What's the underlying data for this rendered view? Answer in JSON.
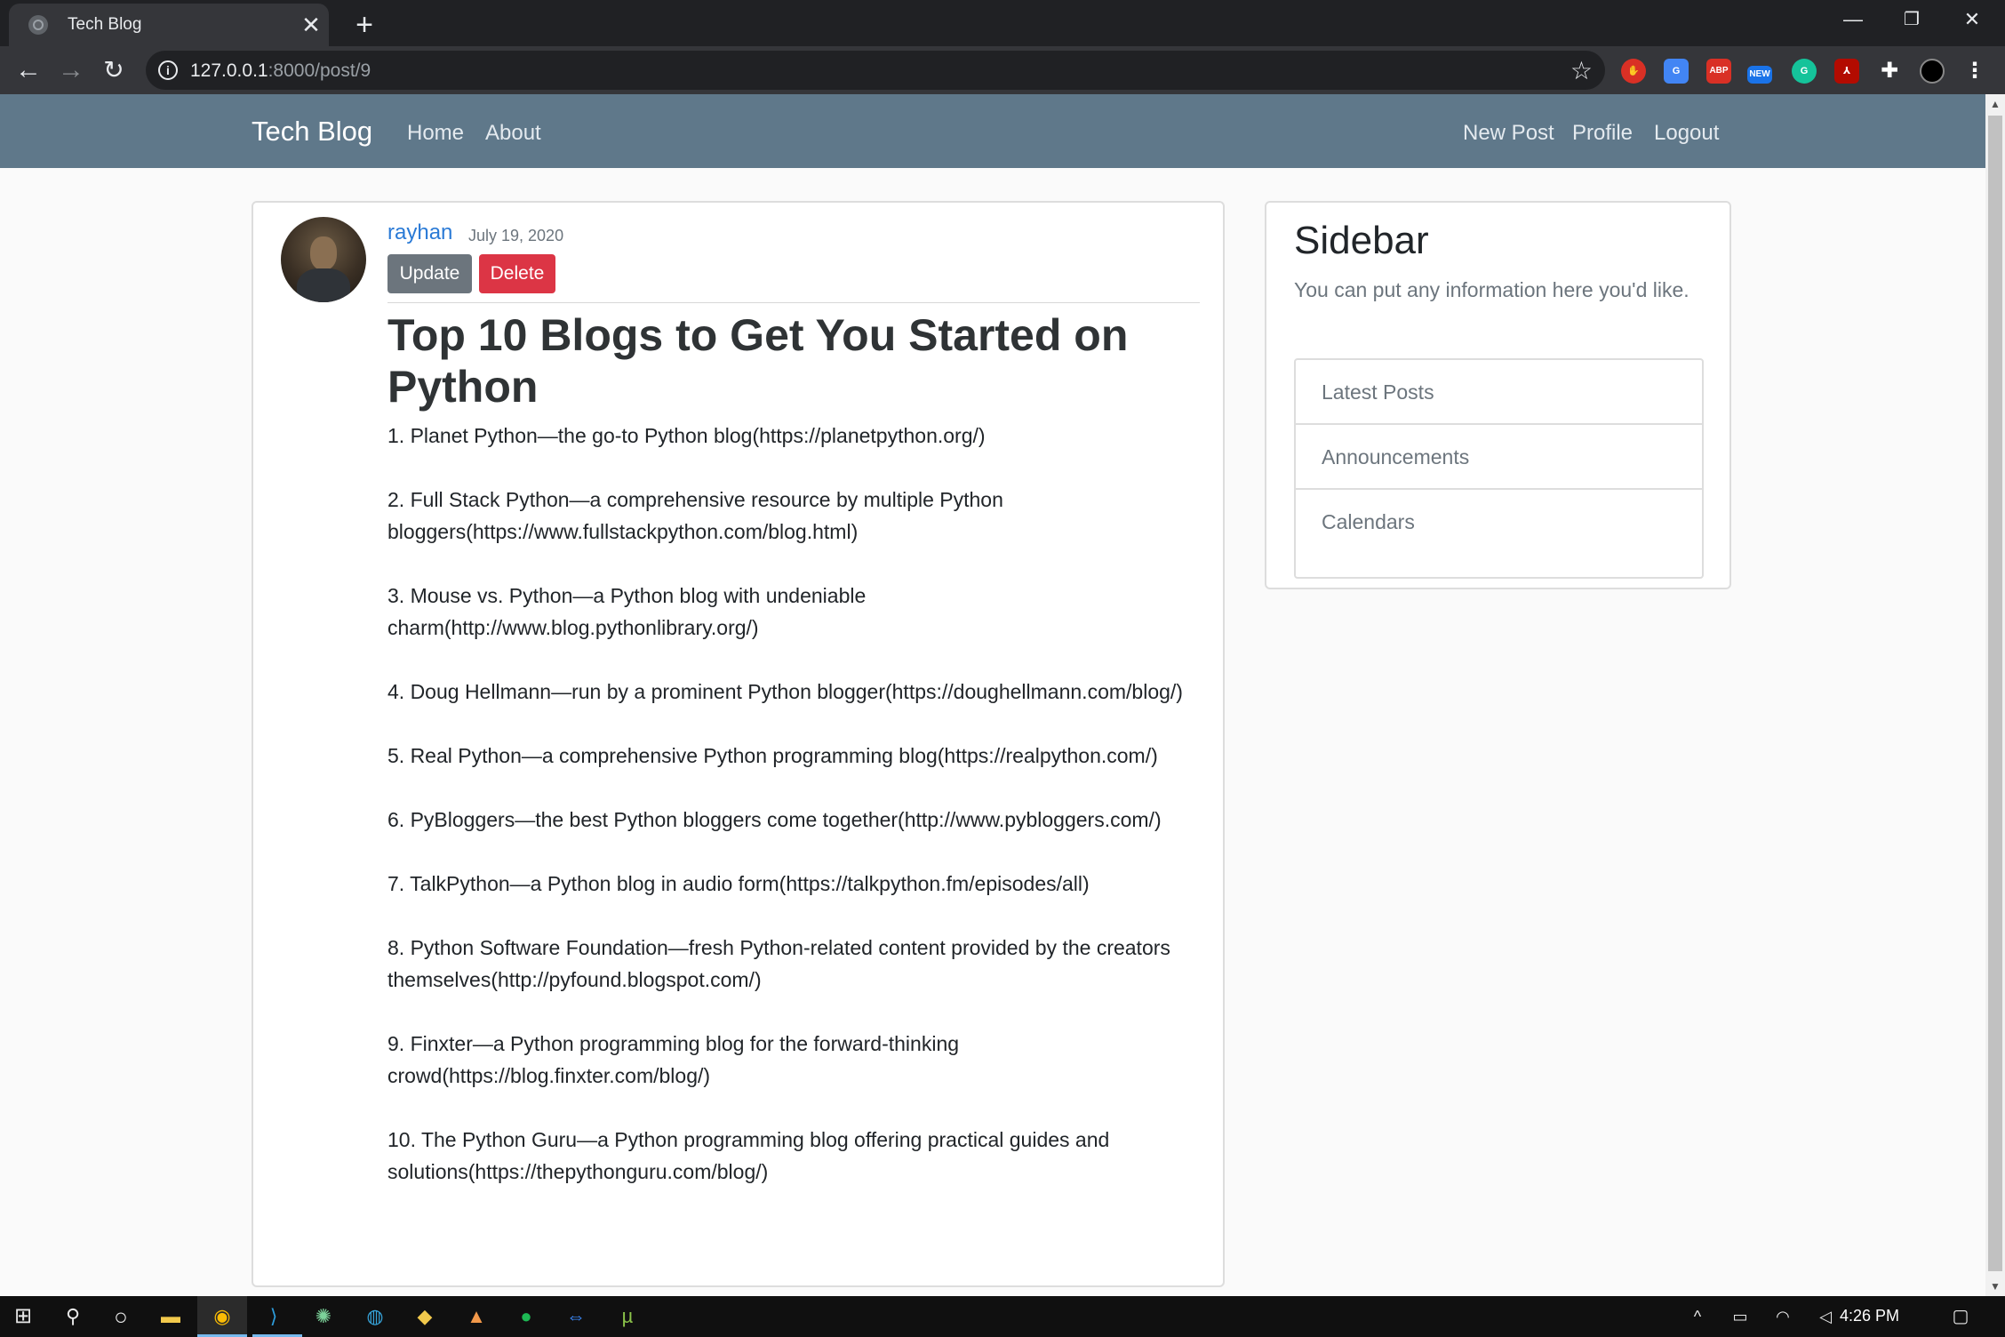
{
  "browser": {
    "tab_title": "Tech Blog",
    "tab_close": "✕",
    "new_tab": "+",
    "url_host": "127.0.0.1",
    "url_rest": ":8000/post/9",
    "extensions": [
      "ABP",
      "NEW"
    ],
    "window_controls": [
      "—",
      "❐",
      "✕"
    ]
  },
  "site": {
    "brand": "Tech Blog",
    "nav_left": [
      "Home",
      "About"
    ],
    "nav_right": [
      "New Post",
      "Profile",
      "Logout"
    ]
  },
  "post": {
    "author": "rayhan",
    "date": "July 19, 2020",
    "update_label": "Update",
    "delete_label": "Delete",
    "title": "Top 10 Blogs to Get You Started on Python",
    "items": [
      "1. Planet Python—the go-to Python blog(https://planetpython.org/)",
      "2. Full Stack Python—a comprehensive resource by multiple Python bloggers(https://www.fullstackpython.com/blog.html)",
      "3. Mouse vs. Python—a Python blog with undeniable charm(http://www.blog.pythonlibrary.org/)",
      "4. Doug Hellmann—run by a prominent Python blogger(https://doughellmann.com/blog/)",
      "5. Real Python—a comprehensive Python programming blog(https://realpython.com/)",
      "6. PyBloggers—the best Python bloggers come together(http://www.pybloggers.com/)",
      "7. TalkPython—a Python blog in audio form(https://talkpython.fm/episodes/all)",
      "8. Python Software Foundation—fresh Python-related content provided by the creators themselves(http://pyfound.blogspot.com/)",
      "9. Finxter—a Python programming blog for the forward-thinking crowd(https://blog.finxter.com/blog/)",
      "10. The Python Guru—a Python programming blog offering practical guides and solutions(https://thepythonguru.com/blog/)"
    ]
  },
  "sidebar": {
    "title": "Sidebar",
    "lead": "You can put any information here you'd like.",
    "items": [
      "Latest Posts",
      "Announcements",
      "Calendars"
    ]
  },
  "taskbar": {
    "clock": "4:26 PM"
  },
  "colors": {
    "navbar": "#5f788a",
    "link": "#2a7ad6",
    "update": "#6c757d",
    "delete": "#dc3545"
  }
}
